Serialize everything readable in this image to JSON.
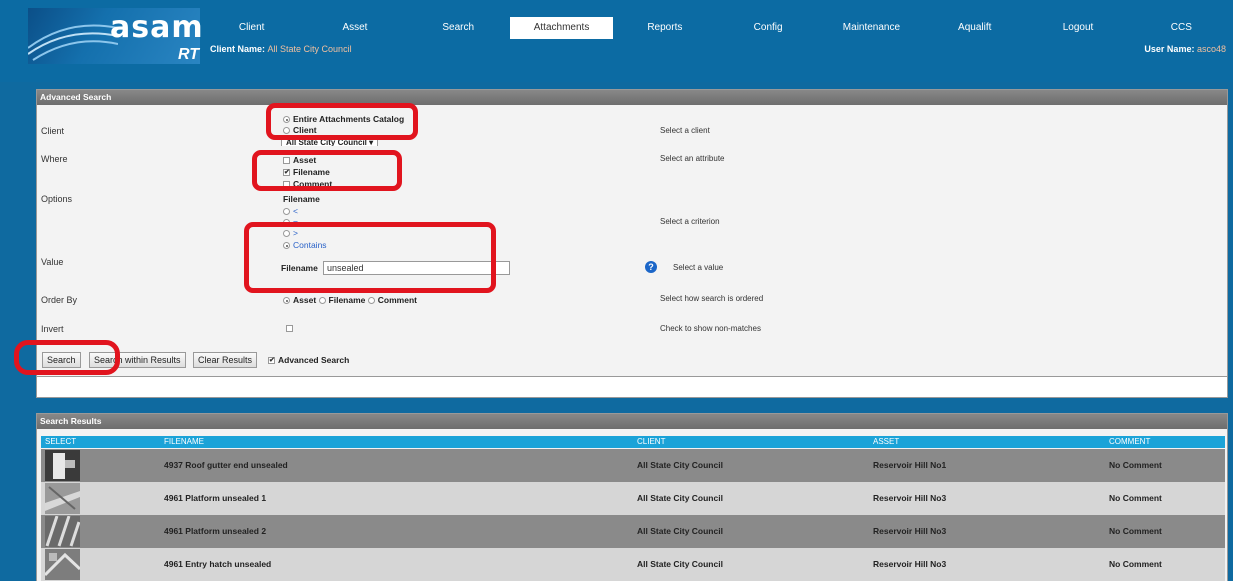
{
  "logo": {
    "text": "asam",
    "sub": "RT"
  },
  "nav": [
    "Client",
    "Asset",
    "Search",
    "Attachments",
    "Reports",
    "Config",
    "Maintenance",
    "Aqualift",
    "Logout",
    "CCS"
  ],
  "nav_active": "Attachments",
  "header": {
    "client_label": "Client Name:",
    "client_value": "All State City Council",
    "user_label": "User Name:",
    "user_value": "asco48"
  },
  "advanced_search": {
    "title": "Advanced Search",
    "client": {
      "label": "Client",
      "opt_entire": "Entire Attachments Catalog",
      "opt_client": "Client",
      "selected_client": "All State City Council",
      "hint": "Select a client"
    },
    "where": {
      "label": "Where",
      "opt_asset": "Asset",
      "opt_filename": "Filename",
      "opt_comment": "Comment",
      "hint": "Select an attribute"
    },
    "options": {
      "label": "Options",
      "heading": "Filename",
      "opt_lt": "<",
      "opt_eq": "=",
      "opt_gt": ">",
      "opt_contains": "Contains",
      "hint": "Select a criterion"
    },
    "value": {
      "label": "Value",
      "field_label": "Filename",
      "field_value": "unsealed",
      "hint": "Select a value",
      "help": "?"
    },
    "order_by": {
      "label": "Order By",
      "opt_asset": "Asset",
      "opt_filename": "Filename",
      "opt_comment": "Comment",
      "hint": "Select how search is ordered"
    },
    "invert": {
      "label": "Invert",
      "hint": "Check to show non-matches"
    },
    "buttons": {
      "search": "Search",
      "search_within": "Search within Results",
      "clear": "Clear Results",
      "advanced": "Advanced Search"
    }
  },
  "results": {
    "title": "Search Results",
    "columns": [
      "SELECT",
      "FILENAME",
      "CLIENT",
      "ASSET",
      "COMMENT"
    ],
    "rows": [
      {
        "filename": "4937 Roof gutter end unsealed",
        "client": "All State City Council",
        "asset": "Reservoir Hill No1",
        "comment": "No Comment"
      },
      {
        "filename": "4961 Platform unsealed 1",
        "client": "All State City Council",
        "asset": "Reservoir Hill No3",
        "comment": "No Comment"
      },
      {
        "filename": "4961 Platform unsealed 2",
        "client": "All State City Council",
        "asset": "Reservoir Hill No3",
        "comment": "No Comment"
      },
      {
        "filename": "4961 Entry hatch unsealed",
        "client": "All State City Council",
        "asset": "Reservoir Hill No3",
        "comment": "No Comment"
      }
    ]
  },
  "colors": {
    "header_bg": "#0c6ba3",
    "table_head": "#1ba3d8",
    "highlight": "#e1141e"
  }
}
